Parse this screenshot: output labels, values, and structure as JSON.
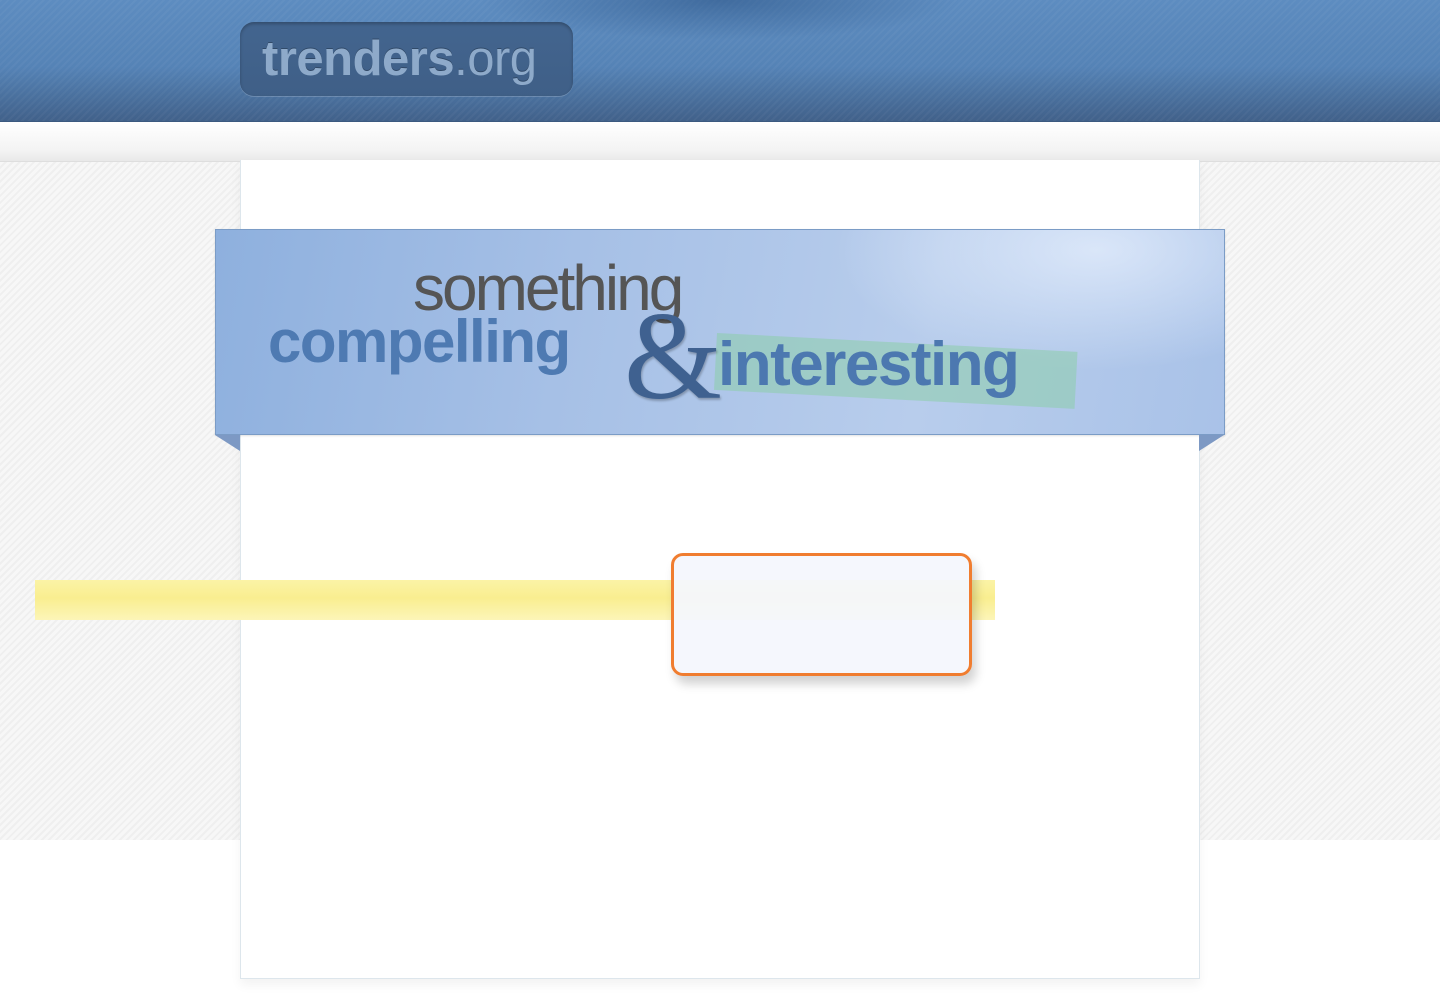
{
  "header": {
    "logo": {
      "name": "trenders",
      "tld": ".org"
    }
  },
  "banner": {
    "line1": "something",
    "line2_left": "compelling",
    "ampersand": "&",
    "line2_right": "interesting"
  },
  "colors": {
    "header_blue": "#5583b6",
    "banner_blue": "#a6c0e6",
    "highlight_green": "#8ccdaa",
    "highlight_yellow": "#f9ee90",
    "focus_orange": "#f07d30"
  }
}
